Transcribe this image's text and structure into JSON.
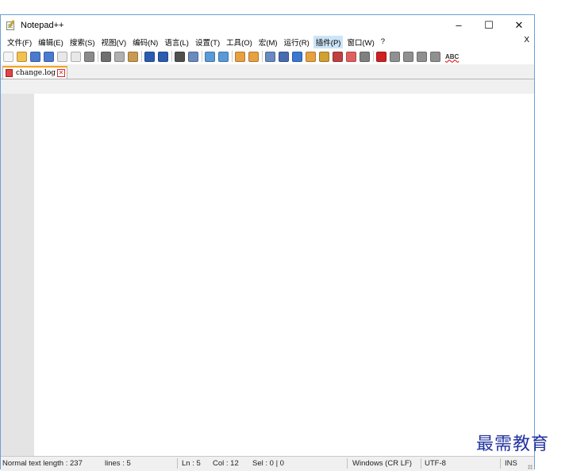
{
  "window": {
    "title": "Notepad++"
  },
  "window_controls": {
    "minimize": "–",
    "maximize": "☐",
    "close": "✕"
  },
  "menu": {
    "items": [
      "文件(F)",
      "编辑(E)",
      "搜索(S)",
      "视图(V)",
      "编码(N)",
      "语言(L)",
      "设置(T)",
      "工具(O)",
      "宏(M)",
      "运行(R)",
      "插件(P)",
      "窗口(W)",
      "?"
    ],
    "active_item": "插件(P)",
    "close_label": "X"
  },
  "toolbar": {
    "buttons": [
      {
        "name": "new-file-icon",
        "color": "#f4f4f4"
      },
      {
        "name": "open-folder-icon",
        "color": "#f2c14e"
      },
      {
        "name": "save-icon",
        "color": "#4a7bd0"
      },
      {
        "name": "save-all-icon",
        "color": "#4a7bd0"
      },
      {
        "name": "close-file-icon",
        "color": "#e8e8e8"
      },
      {
        "name": "close-all-icon",
        "color": "#e8e8e8"
      },
      {
        "name": "print-icon",
        "color": "#8a8a8a"
      },
      {
        "sep": true
      },
      {
        "name": "cut-icon",
        "color": "#707070"
      },
      {
        "name": "copy-icon",
        "color": "#b0b0b0"
      },
      {
        "name": "paste-icon",
        "color": "#c89a50"
      },
      {
        "sep": true
      },
      {
        "name": "undo-icon",
        "color": "#2a5db0"
      },
      {
        "name": "redo-icon",
        "color": "#2a5db0"
      },
      {
        "sep": true
      },
      {
        "name": "find-icon",
        "color": "#505050"
      },
      {
        "name": "replace-icon",
        "color": "#6a8ac0"
      },
      {
        "sep": true
      },
      {
        "name": "zoom-in-icon",
        "color": "#5a9ad8"
      },
      {
        "name": "zoom-out-icon",
        "color": "#5a9ad8"
      },
      {
        "sep": true
      },
      {
        "name": "sync-vertical-icon",
        "color": "#e8a040"
      },
      {
        "name": "sync-horizontal-icon",
        "color": "#e8a040"
      },
      {
        "sep": true
      },
      {
        "name": "word-wrap-icon",
        "color": "#6a8ac0"
      },
      {
        "name": "show-all-chars-icon",
        "color": "#4a6ab0"
      },
      {
        "name": "indent-guide-icon",
        "color": "#3a7ad0"
      },
      {
        "name": "doc-map-icon",
        "color": "#e8a040"
      },
      {
        "name": "function-list-icon",
        "color": "#d0a030"
      },
      {
        "name": "folder-workspace-icon",
        "color": "#c04040"
      },
      {
        "name": "monitor-icon",
        "color": "#e06060"
      },
      {
        "name": "eye-icon",
        "color": "#808080"
      },
      {
        "sep": true
      },
      {
        "name": "record-macro-icon",
        "color": "#d02020"
      },
      {
        "name": "stop-macro-icon",
        "color": "#909090"
      },
      {
        "name": "play-macro-icon",
        "color": "#909090"
      },
      {
        "name": "run-macro-multiple-icon",
        "color": "#909090"
      },
      {
        "name": "save-macro-icon",
        "color": "#909090"
      }
    ],
    "spellcheck_label": "ABC"
  },
  "tabs": [
    {
      "label": "change.log",
      "icon": "file-modified-icon",
      "close": "✕"
    }
  ],
  "status": {
    "length": "Normal text length : 237",
    "lines": "lines : 5",
    "ln": "Ln : 5",
    "col": "Col : 12",
    "sel": "Sel : 0 | 0",
    "eol": "Windows (CR LF)",
    "encoding": "UTF-8",
    "mode": "INS"
  },
  "watermark": "最需教育"
}
